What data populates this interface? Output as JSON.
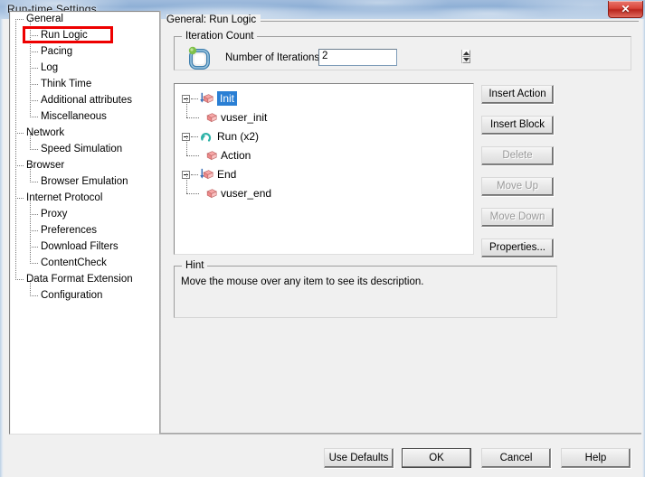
{
  "window": {
    "title": "Run-time Settings",
    "close_label": "✕",
    "close_icon": "close-icon"
  },
  "sidebar": {
    "items": [
      {
        "label": "General",
        "level": 0,
        "highlighted": false
      },
      {
        "label": "Run Logic",
        "level": 1,
        "highlighted": true
      },
      {
        "label": "Pacing",
        "level": 1,
        "highlighted": false
      },
      {
        "label": "Log",
        "level": 1,
        "highlighted": false
      },
      {
        "label": "Think Time",
        "level": 1,
        "highlighted": false
      },
      {
        "label": "Additional attributes",
        "level": 1,
        "highlighted": false
      },
      {
        "label": "Miscellaneous",
        "level": 1,
        "highlighted": false
      },
      {
        "label": "Network",
        "level": 0,
        "highlighted": false
      },
      {
        "label": "Speed Simulation",
        "level": 1,
        "highlighted": false
      },
      {
        "label": "Browser",
        "level": 0,
        "highlighted": false
      },
      {
        "label": "Browser Emulation",
        "level": 1,
        "highlighted": false
      },
      {
        "label": "Internet Protocol",
        "level": 0,
        "highlighted": false
      },
      {
        "label": "Proxy",
        "level": 1,
        "highlighted": false
      },
      {
        "label": "Preferences",
        "level": 1,
        "highlighted": false
      },
      {
        "label": "Download Filters",
        "level": 1,
        "highlighted": false
      },
      {
        "label": "ContentCheck",
        "level": 1,
        "highlighted": false
      },
      {
        "label": "Data Format Extension",
        "level": 0,
        "highlighted": false
      },
      {
        "label": "Configuration",
        "level": 1,
        "highlighted": false
      }
    ]
  },
  "content": {
    "page_title": "General: Run Logic",
    "iteration_group": {
      "label": "Iteration Count",
      "icon": "iteration-loop-icon",
      "field_label": "Number of Iterations:",
      "value": "2",
      "placeholder": ""
    },
    "run_logic_tree": [
      {
        "label": "Init",
        "level": 0,
        "icon": "init-block-icon",
        "selected": true,
        "expander": "minus"
      },
      {
        "label": "vuser_init",
        "level": 1,
        "icon": "action-block-icon",
        "selected": false,
        "expander": ""
      },
      {
        "label": "Run (x2)",
        "level": 0,
        "icon": "run-loop-icon",
        "selected": false,
        "expander": "minus"
      },
      {
        "label": "Action",
        "level": 1,
        "icon": "action-block-icon",
        "selected": false,
        "expander": ""
      },
      {
        "label": "End",
        "level": 0,
        "icon": "end-block-icon",
        "selected": false,
        "expander": "minus"
      },
      {
        "label": "vuser_end",
        "level": 1,
        "icon": "action-block-icon",
        "selected": false,
        "expander": ""
      }
    ],
    "side_buttons": [
      {
        "label": "Insert Action",
        "enabled": true
      },
      {
        "label": "Insert Block",
        "enabled": true
      },
      {
        "label": "Delete",
        "enabled": false
      },
      {
        "label": "Move Up",
        "enabled": false
      },
      {
        "label": "Move Down",
        "enabled": false
      },
      {
        "label": "Properties...",
        "enabled": true
      }
    ],
    "hint": {
      "label": "Hint",
      "text": "Move the mouse over any item to see its description."
    }
  },
  "footer": {
    "buttons": [
      {
        "label": "Use Defaults",
        "default": false
      },
      {
        "label": "OK",
        "default": true
      },
      {
        "label": "Cancel",
        "default": false
      },
      {
        "label": "Help",
        "default": false
      }
    ]
  },
  "annotation": {
    "highlight_color": "#ee0000",
    "target": "Run Logic"
  },
  "colors": {
    "selection": "#2a7fd4",
    "title_bar": "#9fbbdc",
    "close_button": "#d9453a",
    "dialog_bg": "#f0f0f0"
  }
}
